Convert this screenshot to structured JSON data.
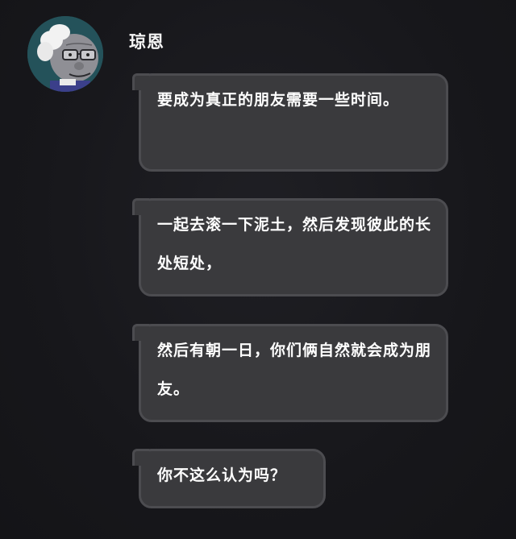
{
  "sender": {
    "name": "琼恩",
    "avatar_icon": "cartoon-old-man-avatar"
  },
  "messages": [
    {
      "text": "要成为真正的朋友需要一些时间。"
    },
    {
      "text": "一起去滚一下泥土，然后发现彼此的长处短处，"
    },
    {
      "text": "然后有朝一日，你们俩自然就会成为朋友。"
    },
    {
      "text": "你不这么认为吗？"
    }
  ],
  "colors": {
    "background": "#18181c",
    "bubble": "#3a3a3d",
    "bubble_border": "#4c4c50",
    "text": "#ffffff"
  }
}
